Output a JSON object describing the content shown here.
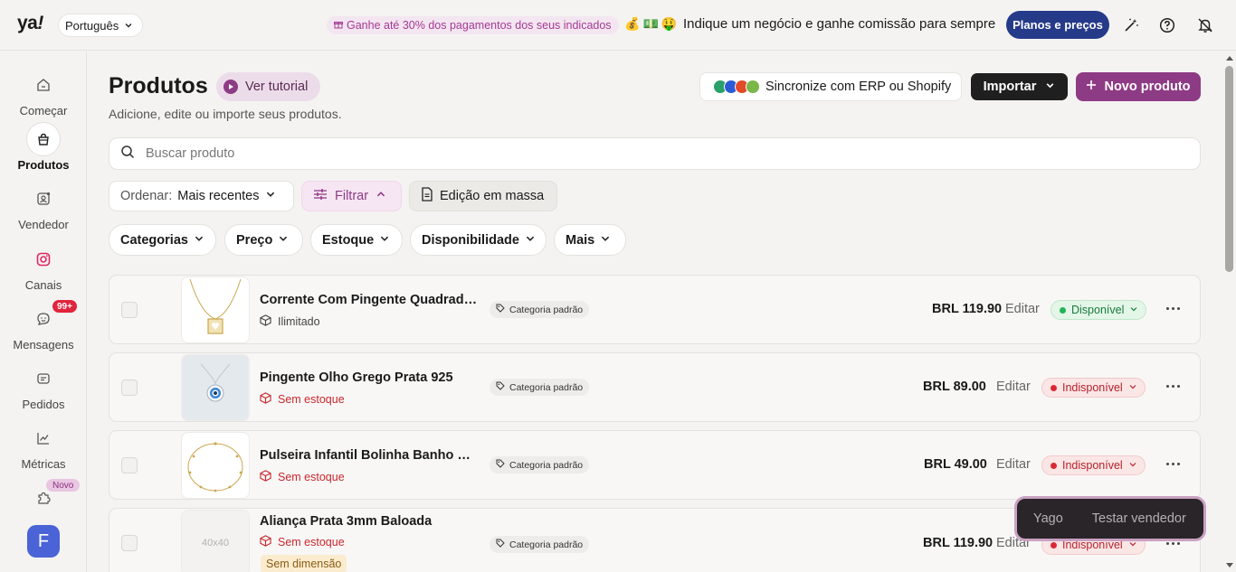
{
  "topbar": {
    "logo": "ya",
    "logo_mark": "!",
    "language": "Português",
    "promo": "Ganhe até 30% dos pagamentos dos seus indicados",
    "emojis": [
      "💰",
      "💵",
      "🤑"
    ],
    "referral_text": "Indique um negócio e ganhe comissão para sempre",
    "plans_button": "Planos e preços",
    "icons": [
      "magic-wand-icon",
      "help-icon",
      "notifications-off-icon"
    ]
  },
  "sidebar": {
    "items": [
      {
        "label": "Começar",
        "icon": "home-icon"
      },
      {
        "label": "Produtos",
        "icon": "product-icon",
        "active": true
      },
      {
        "label": "Vendedor",
        "icon": "seller-icon"
      },
      {
        "label": "Canais",
        "icon": "instagram-icon"
      },
      {
        "label": "Mensagens",
        "icon": "messages-icon",
        "badge": "99+"
      },
      {
        "label": "Pedidos",
        "icon": "orders-icon"
      },
      {
        "label": "Métricas",
        "icon": "metrics-icon"
      },
      {
        "label": "",
        "icon": "puzzle-icon",
        "badge": "Novo"
      }
    ],
    "avatar_initial": "F"
  },
  "header": {
    "title": "Produtos",
    "tutorial_button": "Ver tutorial",
    "subtitle": "Adicione, edite ou importe seus produtos.",
    "sync_button": "Sincronize com ERP ou Shopify",
    "import_button": "Importar",
    "new_product_button": "Novo produto"
  },
  "search": {
    "placeholder": "Buscar produto",
    "value": ""
  },
  "toolbar": {
    "sort_label": "Ordenar:",
    "sort_value": "Mais recentes",
    "filter_button": "Filtrar",
    "bulk_edit_button": "Edição em massa"
  },
  "filters": [
    "Categorias",
    "Preço",
    "Estoque",
    "Disponibilidade",
    "Mais"
  ],
  "products": [
    {
      "name": "Corrente Com Pingente Quadrado...",
      "stock": "Ilimitado",
      "stock_status": "ok",
      "category": "Categoria padrão",
      "price": "BRL 119.90",
      "edit": "Editar",
      "status": "Disponível",
      "status_type": "ok",
      "thumb": "necklace-image"
    },
    {
      "name": "Pingente Olho Grego Prata 925",
      "stock": "Sem estoque",
      "stock_status": "out",
      "category": "Categoria padrão",
      "price": "BRL 89.00",
      "edit": "Editar",
      "status": "Indisponível",
      "status_type": "no",
      "thumb": "eye-pendant-image"
    },
    {
      "name": "Pulseira Infantil Bolinha Banho Ou...",
      "stock": "Sem estoque",
      "stock_status": "out",
      "category": "Categoria padrão",
      "price": "BRL 49.00",
      "edit": "Editar",
      "status": "Indisponível",
      "status_type": "no",
      "thumb": "bracelet-image"
    },
    {
      "name": "Aliança Prata 3mm Baloada",
      "stock": "Sem estoque",
      "stock_status": "out",
      "category": "Categoria padrão",
      "price": "BRL 119.90",
      "edit": "Editar",
      "status": "Indisponível",
      "status_type": "no",
      "thumb_placeholder": "40x40",
      "extra_badge": "Sem dimensão"
    }
  ],
  "floating_seller": {
    "name": "Yago",
    "action": "Testar vendedor"
  },
  "colors": {
    "brand": "#8e3b85",
    "plans": "#263a8a",
    "available": "#22b357",
    "unavailable": "#d92a34"
  }
}
